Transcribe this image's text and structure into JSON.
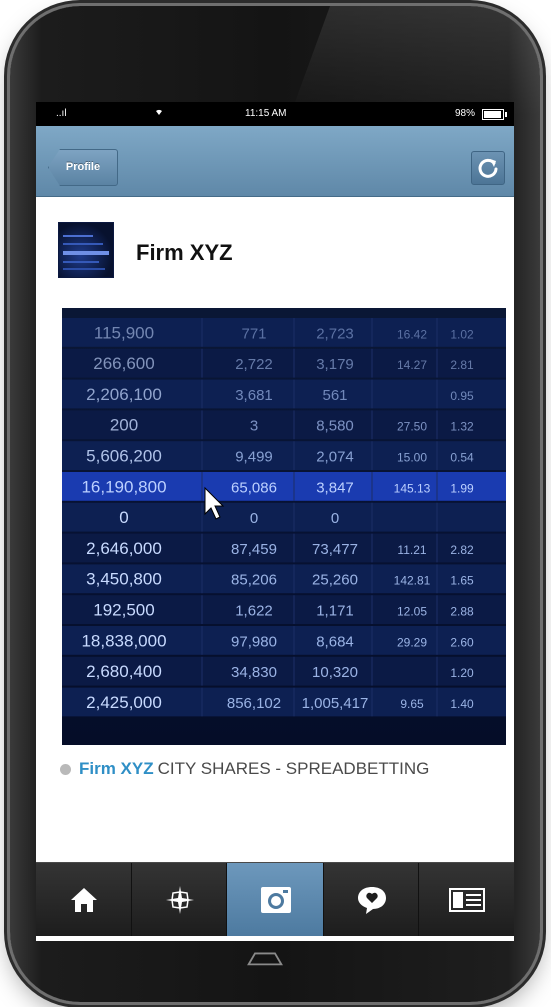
{
  "status_bar": {
    "signal": "..ıl",
    "wifi": "⇡",
    "time": "11:15 AM",
    "battery": "98%"
  },
  "nav": {
    "back_label": "Profile"
  },
  "profile": {
    "name": "Firm XYZ"
  },
  "caption": {
    "firm": "Firm XYZ",
    "text": "CITY SHARES - SPREADBETTING"
  },
  "photo_rows": [
    [
      "115,900",
      "771",
      "2,723",
      "16.42",
      "1.02"
    ],
    [
      "266,600",
      "2,722",
      "3,179",
      "14.27",
      "2.81"
    ],
    [
      "2,206,100",
      "3,681",
      "561",
      "",
      "0.95"
    ],
    [
      "200",
      "3",
      "8,580",
      "27.50",
      "1.32"
    ],
    [
      "5,606,200",
      "9,499",
      "2,074",
      "15.00",
      "0.54"
    ],
    [
      "16,190,800",
      "65,086",
      "3,847",
      "145.13",
      "1.99"
    ],
    [
      "0",
      "0",
      "0",
      "",
      ""
    ],
    [
      "2,646,000",
      "87,459",
      "73,477",
      "11.21",
      "2.82"
    ],
    [
      "3,450,800",
      "85,206",
      "25,260",
      "142.81",
      "1.65"
    ],
    [
      "192,500",
      "1,622",
      "1,171",
      "12.05",
      "2.88"
    ],
    [
      "18,838,000",
      "97,980",
      "8,684",
      "29.29",
      "2.60"
    ],
    [
      "2,680,400",
      "34,830",
      "10,320",
      "",
      "1.20"
    ],
    [
      "2,425,000",
      "856,102",
      "1,005,417",
      "9.65",
      "1.40"
    ]
  ],
  "tabs": [
    {
      "name": "home",
      "icon": "home-icon"
    },
    {
      "name": "explore",
      "icon": "compass-star-icon"
    },
    {
      "name": "camera",
      "icon": "camera-icon",
      "active": true
    },
    {
      "name": "activity",
      "icon": "heart-bubble-icon"
    },
    {
      "name": "profile",
      "icon": "profile-card-icon"
    }
  ],
  "colors": {
    "nav_blue": "#6a93b4",
    "accent": "#2f8fc6",
    "tab_active": "#5c88ae"
  }
}
